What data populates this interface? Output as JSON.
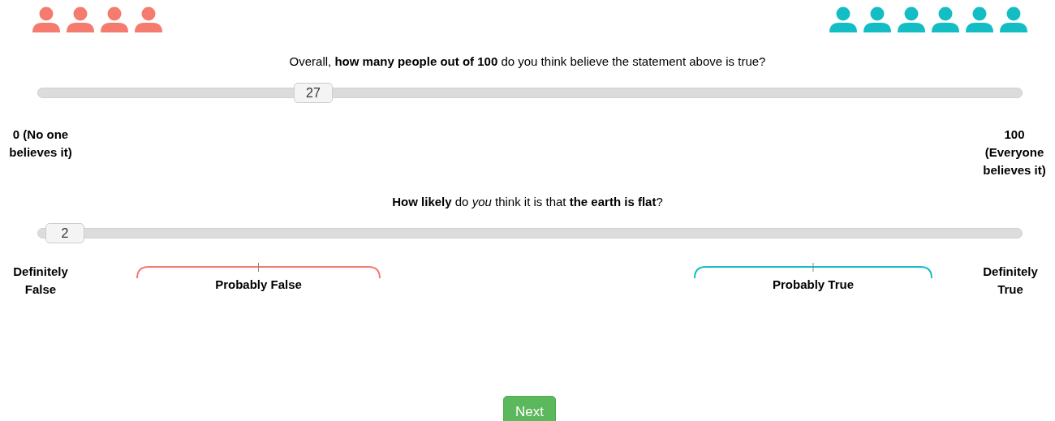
{
  "crowds": [
    {
      "people": [
        {
          "color": "#f47b6d"
        },
        {
          "color": "#f47b6d"
        },
        {
          "color": "#f47b6d"
        },
        {
          "color": "#f47b6d"
        }
      ]
    },
    {
      "people": [
        {
          "color": "#14bdc4"
        },
        {
          "color": "#14bdc4"
        },
        {
          "color": "#14bdc4"
        },
        {
          "color": "#14bdc4"
        },
        {
          "color": "#14bdc4"
        },
        {
          "color": "#14bdc4"
        }
      ]
    }
  ],
  "questions": [
    {
      "text": "Overall, **how many people out of 100** do you think believe the statement above is true?",
      "slider": {
        "level": 0.28,
        "value": "27"
      },
      "min_label": "0 (No one believes it)",
      "max_label": "100 (Everyone believes it)"
    },
    {
      "text": "**How likely** do *you* think it is that **the earth is flat**?",
      "slider": {
        "level": 0.028,
        "value": "2"
      },
      "min_label": "Definitely False",
      "max_label": "Definitely True",
      "zones": [
        {
          "label": "Probably False",
          "color": "#f47b6d"
        },
        {
          "label": "Probably True",
          "color": "#14bdc4"
        }
      ]
    }
  ],
  "next_button": "Next"
}
